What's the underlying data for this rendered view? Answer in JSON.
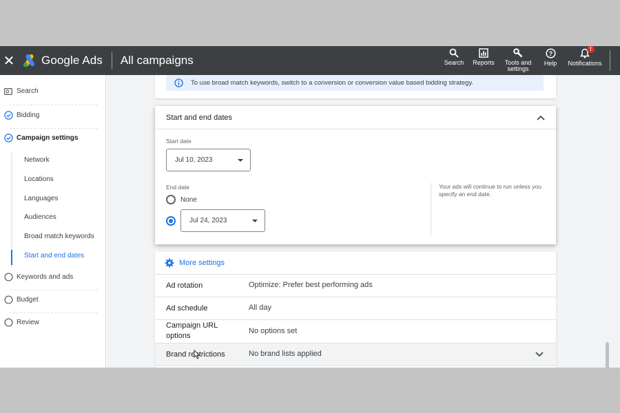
{
  "topbar": {
    "close_icon": "close-icon",
    "brand": "Google Ads",
    "title": "All campaigns",
    "tools": [
      {
        "label": "Search",
        "icon": "search-icon"
      },
      {
        "label": "Reports",
        "icon": "reports-icon"
      },
      {
        "label": "Tools and settings",
        "icon": "wrench-icon"
      },
      {
        "label": "Help",
        "icon": "help-icon"
      },
      {
        "label": "Notifications",
        "icon": "bell-icon",
        "badge": "!"
      }
    ]
  },
  "sidebar": {
    "items": [
      {
        "label": "Search",
        "icon": "ad-icon",
        "state": "done"
      },
      {
        "label": "Bidding",
        "icon": "check-circle-icon",
        "state": "done"
      },
      {
        "label": "Campaign settings",
        "icon": "check-circle-icon",
        "state": "active"
      },
      {
        "label": "Keywords and ads",
        "icon": "circle-icon",
        "state": "todo"
      },
      {
        "label": "Budget",
        "icon": "circle-icon",
        "state": "todo"
      },
      {
        "label": "Review",
        "icon": "circle-icon",
        "state": "todo"
      }
    ],
    "subitems": [
      "Network",
      "Locations",
      "Languages",
      "Audiences",
      "Broad match keywords",
      "Start and end dates"
    ],
    "current_subitem": "Start and end dates"
  },
  "info_banner": {
    "text": "To use broad match keywords, switch to a conversion or conversion value based bidding strategy.",
    "icon": "info-icon"
  },
  "dates": {
    "title": "Start and end dates",
    "start_label": "Start date",
    "start_value": "Jul 10, 2023",
    "end_label": "End date",
    "none_label": "None",
    "end_value": "Jul 24, 2023",
    "end_selected": "date",
    "helper": "Your ads will continue to run unless you specify an end date."
  },
  "more_settings": {
    "label": "More settings",
    "icon": "gear-icon",
    "rows": [
      {
        "label": "Ad rotation",
        "value": "Optimize: Prefer best performing ads"
      },
      {
        "label": "Ad schedule",
        "value": "All day"
      },
      {
        "label": "Campaign URL options",
        "value": "No options set"
      },
      {
        "label": "Brand restrictions",
        "value": "No brand lists applied"
      }
    ]
  },
  "colors": {
    "topbar": "#3c4043",
    "accent": "#1a73e8",
    "banner": "#e8f0fe",
    "notification": "#d93025"
  }
}
